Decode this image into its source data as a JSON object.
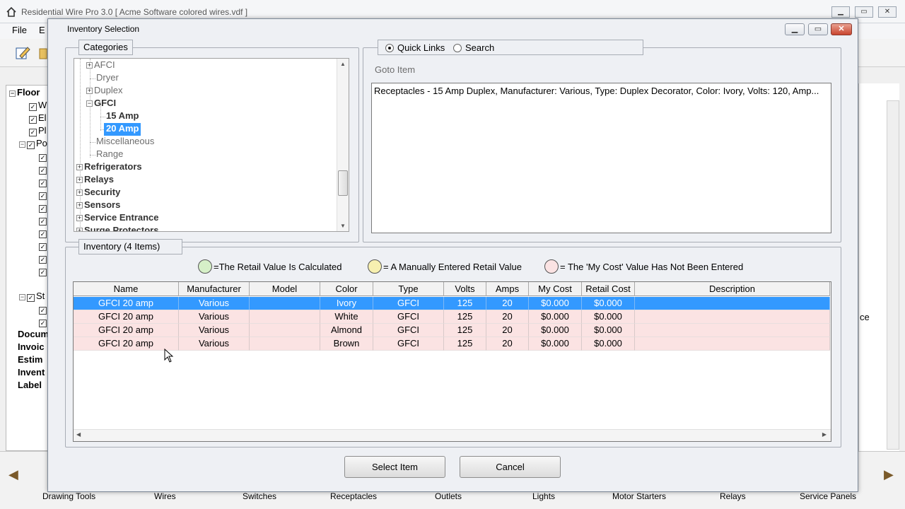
{
  "app": {
    "title": "Residential Wire Pro 3.0 [ Acme Software colored wires.vdf ]",
    "menu": {
      "file": "File",
      "edit": "E"
    },
    "tree": {
      "root": "Floor",
      "items": [
        {
          "label": "W"
        },
        {
          "label": "El"
        },
        {
          "label": "Pl"
        },
        {
          "label": "Po"
        }
      ],
      "st": "St",
      "bottom": [
        "Docum",
        "Invoic",
        "Estim",
        "Invent",
        "Label"
      ]
    },
    "right_text": "ce",
    "bottom_tabs": [
      "Drawing Tools",
      "Wires",
      "Switches",
      "Receptacles",
      "Outlets",
      "Lights",
      "Motor Starters",
      "Relays",
      "Service Panels"
    ]
  },
  "dialog": {
    "title": "Inventory Selection",
    "categories": {
      "label": "Categories",
      "nodes": [
        {
          "label": "AFCI",
          "expander": "+",
          "style": "gray"
        },
        {
          "label": "Dryer",
          "expander": "",
          "style": "gray"
        },
        {
          "label": "Duplex",
          "expander": "+",
          "style": "gray"
        },
        {
          "label": "GFCI",
          "expander": "−",
          "style": "bold"
        },
        {
          "label": "15 Amp",
          "expander": "",
          "style": "bold"
        },
        {
          "label": "20 Amp",
          "expander": "",
          "style": "sel"
        },
        {
          "label": "Miscellaneous",
          "expander": "",
          "style": "gray"
        },
        {
          "label": "Range",
          "expander": "",
          "style": "gray"
        },
        {
          "label": "Refrigerators",
          "expander": "+",
          "style": "bold"
        },
        {
          "label": "Relays",
          "expander": "+",
          "style": "bold"
        },
        {
          "label": "Security",
          "expander": "+",
          "style": "bold"
        },
        {
          "label": "Sensors",
          "expander": "+",
          "style": "bold"
        },
        {
          "label": "Service Entrance",
          "expander": "+",
          "style": "bold"
        },
        {
          "label": "Surge Protectors",
          "expander": "+",
          "style": "bold"
        }
      ]
    },
    "quick": {
      "quick_links": "Quick Links",
      "search": "Search",
      "selected": "quick_links",
      "goto_label": "Goto Item",
      "goto_text": "Receptacles - 15 Amp Duplex, Manufacturer: Various, Type: Duplex Decorator, Color: Ivory, Volts: 120, Amp..."
    },
    "inventory": {
      "label": "Inventory (4 Items)",
      "legend": [
        {
          "text": "=The Retail Value Is Calculated",
          "color": "#d6f0c8"
        },
        {
          "text": "= A Manually Entered Retail Value",
          "color": "#f7f0b0"
        },
        {
          "text": "= The 'My Cost' Value Has Not Been  Entered",
          "color": "#fbe3e3"
        }
      ],
      "columns": [
        "Name",
        "Manufacturer",
        "Model",
        "Color",
        "Type",
        "Volts",
        "Amps",
        "My Cost",
        "Retail Cost",
        "Description"
      ],
      "rows": [
        [
          "GFCI 20 amp",
          "Various",
          "",
          "Ivory",
          "GFCI",
          "125",
          "20",
          "$0.000",
          "$0.000",
          ""
        ],
        [
          "GFCI 20 amp",
          "Various",
          "",
          "White",
          "GFCI",
          "125",
          "20",
          "$0.000",
          "$0.000",
          ""
        ],
        [
          "GFCI 20 amp",
          "Various",
          "",
          "Almond",
          "GFCI",
          "125",
          "20",
          "$0.000",
          "$0.000",
          ""
        ],
        [
          "GFCI 20 amp",
          "Various",
          "",
          "Brown",
          "GFCI",
          "125",
          "20",
          "$0.000",
          "$0.000",
          ""
        ]
      ],
      "selected_row": 0,
      "colors": {
        "selected": "#3399ff",
        "row_bg": "#fbe3e3"
      }
    },
    "buttons": {
      "select": "Select Item",
      "cancel": "Cancel"
    }
  }
}
